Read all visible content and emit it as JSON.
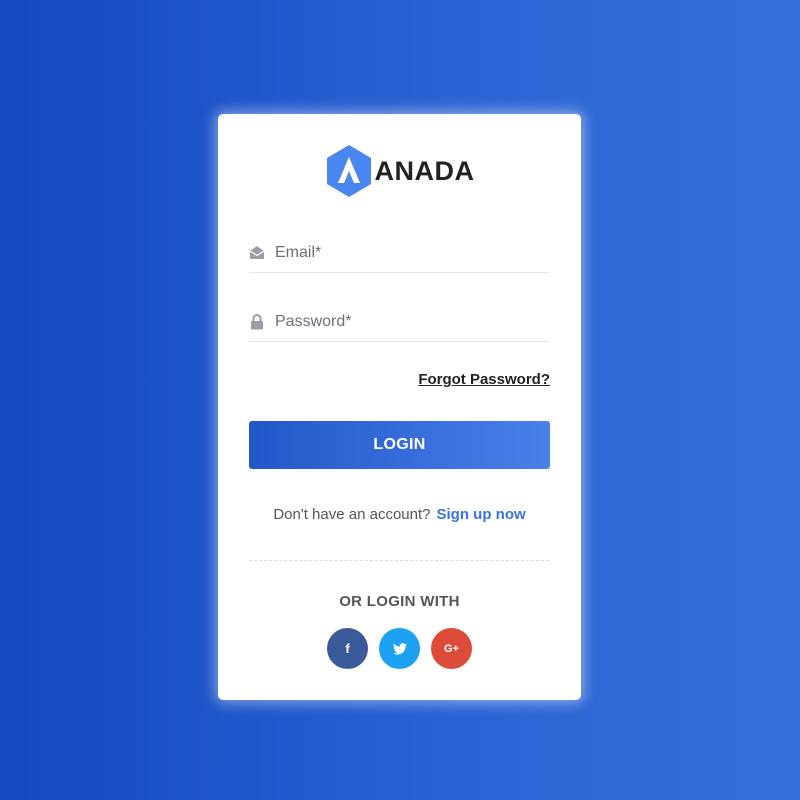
{
  "brand": {
    "name": "ANADA",
    "logo_icon": "hexagon-a-logo-icon",
    "logo_color": "#4a86f0"
  },
  "form": {
    "email_placeholder": "Email*",
    "email_value": "",
    "email_icon": "envelope-open-icon",
    "password_placeholder": "Password*",
    "password_value": "",
    "password_icon": "lock-icon",
    "forgot_label": "Forgot Password?",
    "login_label": "LOGIN"
  },
  "signup": {
    "prompt": "Don't have an account?",
    "link_label": "Sign up now"
  },
  "social": {
    "heading": "OR LOGIN WITH",
    "facebook_glyph": "f",
    "twitter_icon": "twitter-bird-icon",
    "google_glyph": "G+"
  },
  "colors": {
    "accent": "#3a73dc",
    "facebook": "#3b5a9a",
    "twitter": "#1da1f2",
    "google": "#dd4b39"
  }
}
